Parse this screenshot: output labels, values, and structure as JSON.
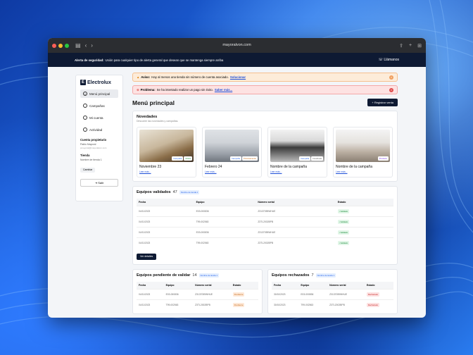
{
  "browser": {
    "url": "mayoralvon.com"
  },
  "alert_bar": {
    "title": "Alerta de seguridad:",
    "text": "Usión para cualquier tipo de alerta general que desean que se mantenga siempre arriba",
    "call": "Llámanos"
  },
  "sidebar": {
    "logo": "Electrolux",
    "items": [
      {
        "label": "Menú principal",
        "icon": "home-icon"
      },
      {
        "label": "Campañas",
        "icon": "megaphone-icon"
      },
      {
        "label": "Mi cuenta",
        "icon": "user-icon"
      },
      {
        "label": "Actividad",
        "icon": "activity-icon"
      }
    ],
    "owner_heading": "Cuenta propietario",
    "owner_name": "Pablo Mayoral",
    "owner_email": "pmayoral@mayoralvon.com",
    "store_heading": "Tienda",
    "store_name": "Nombre de tienda 1",
    "change": "Cambiar",
    "logout": "Salir"
  },
  "banners": {
    "warning": {
      "title": "Aviso:",
      "text": "Hay al menos una tienda sin número de cuenta asociado.",
      "link": "Solucionar"
    },
    "error": {
      "title": "Problema:",
      "text": "Se ha intentado realizar un pago sin éxito.",
      "link": "Saber más..."
    }
  },
  "page": {
    "title": "Menú principal",
    "register_button": "+ Registrar venta"
  },
  "news": {
    "title": "Novedades",
    "subtitle": "Descubre las novedades y campañas.",
    "items": [
      {
        "title": "Noviembre 23",
        "link": "Leer más...",
        "tags": [
          "Campaña",
          "Activa"
        ]
      },
      {
        "title": "Febrero 24",
        "link": "Leer más...",
        "tags": [
          "Campaña",
          "Próximamente"
        ]
      },
      {
        "title": "Nombre de la campaña",
        "link": "Leer más...",
        "tags": [
          "Campaña",
          "Finalizada"
        ]
      },
      {
        "title": "Nombre de la campaña",
        "link": "Leer más...",
        "tags": [
          "Producto"
        ]
      }
    ]
  },
  "validated": {
    "title": "Equipos validados",
    "count": "47",
    "store": "Nombre de tienda 1",
    "columns": [
      "Fecha",
      "Equipo",
      "Número serial",
      "Estado"
    ],
    "rows": [
      [
        "04/11/2023",
        "E03-000836",
        "Z3137059WHUE",
        "• Validado"
      ],
      [
        "04/11/2023",
        "T99-002563",
        "Z3TL2002BPB",
        "• Validado"
      ],
      [
        "04/11/2023",
        "E03-000836",
        "Z3137059WHUE",
        "• Validado"
      ],
      [
        "04/11/2023",
        "T99-002563",
        "Z3TL2002BPB",
        "• Validado"
      ]
    ],
    "details": "Ver detalles"
  },
  "pending": {
    "title": "Equipos pendiente de validar",
    "count": "14",
    "store": "Nombre de tienda 1",
    "columns": [
      "Fecha",
      "Equipo",
      "Número serial",
      "Estado"
    ],
    "rows": [
      [
        "04/11/2023",
        "E03-000836",
        "Z3137059WHUE",
        "Pendiente"
      ],
      [
        "04/11/2023",
        "T99-002563",
        "Z3TL2002BPB",
        "Pendiente"
      ]
    ]
  },
  "rejected": {
    "title": "Equipos rechazados",
    "count": "7",
    "store": "Nombre de tienda 1",
    "columns": [
      "Fecha",
      "Equipo",
      "Número serial",
      "Estado"
    ],
    "rows": [
      [
        "30/10/2023",
        "E03-000836",
        "Z3137059WHUE",
        "Rechazado"
      ],
      [
        "30/10/2023",
        "T99-002563",
        "Z3TL2002BPB",
        "Rechazado"
      ]
    ]
  }
}
